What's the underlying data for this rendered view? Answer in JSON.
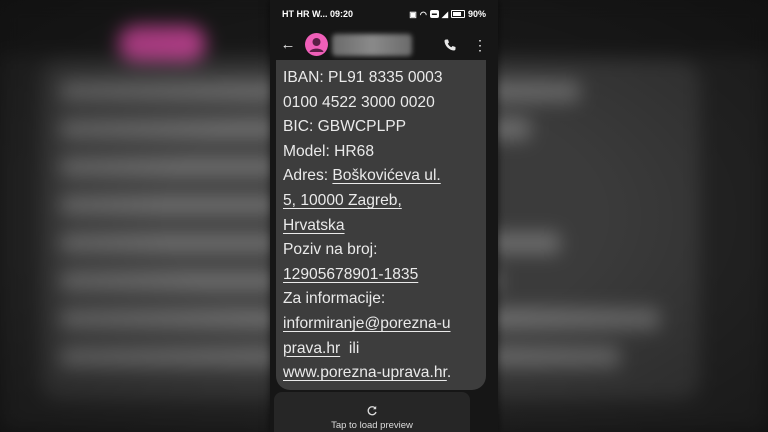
{
  "status_bar": {
    "left_text": "HT HR W... 09:20",
    "battery_percent": "90%"
  },
  "header": {
    "avatar_color": "#ef5fb8"
  },
  "message": {
    "lines": [
      {
        "text": "IBAN: PL91 8335 0003",
        "link": false
      },
      {
        "text": "0100 4522 3000 0020",
        "link": false
      },
      {
        "text": "BIC: GBWCPLPP",
        "link": false
      },
      {
        "text": "Model: HR68",
        "link": false
      }
    ],
    "address_label": "Adres: ",
    "address_line1": "Boškovićeva ul.",
    "address_line2": "5, 10000 Zagreb,",
    "address_line3": "Hrvatska",
    "reference_label": "Poziv na broj:",
    "reference_number": "12905678901-1835",
    "info_label": "Za informacije:",
    "email_part1": "informiranje@porezna-u",
    "email_part2": "prava.hr",
    "or_text": "  ili",
    "website": "www.porezna-uprava.hr",
    "website_trailing": "."
  },
  "preview": {
    "label": "Tap to load preview"
  },
  "colors": {
    "bubble": "#3d3d3d",
    "background": "#161616",
    "text": "#eaeaea"
  }
}
